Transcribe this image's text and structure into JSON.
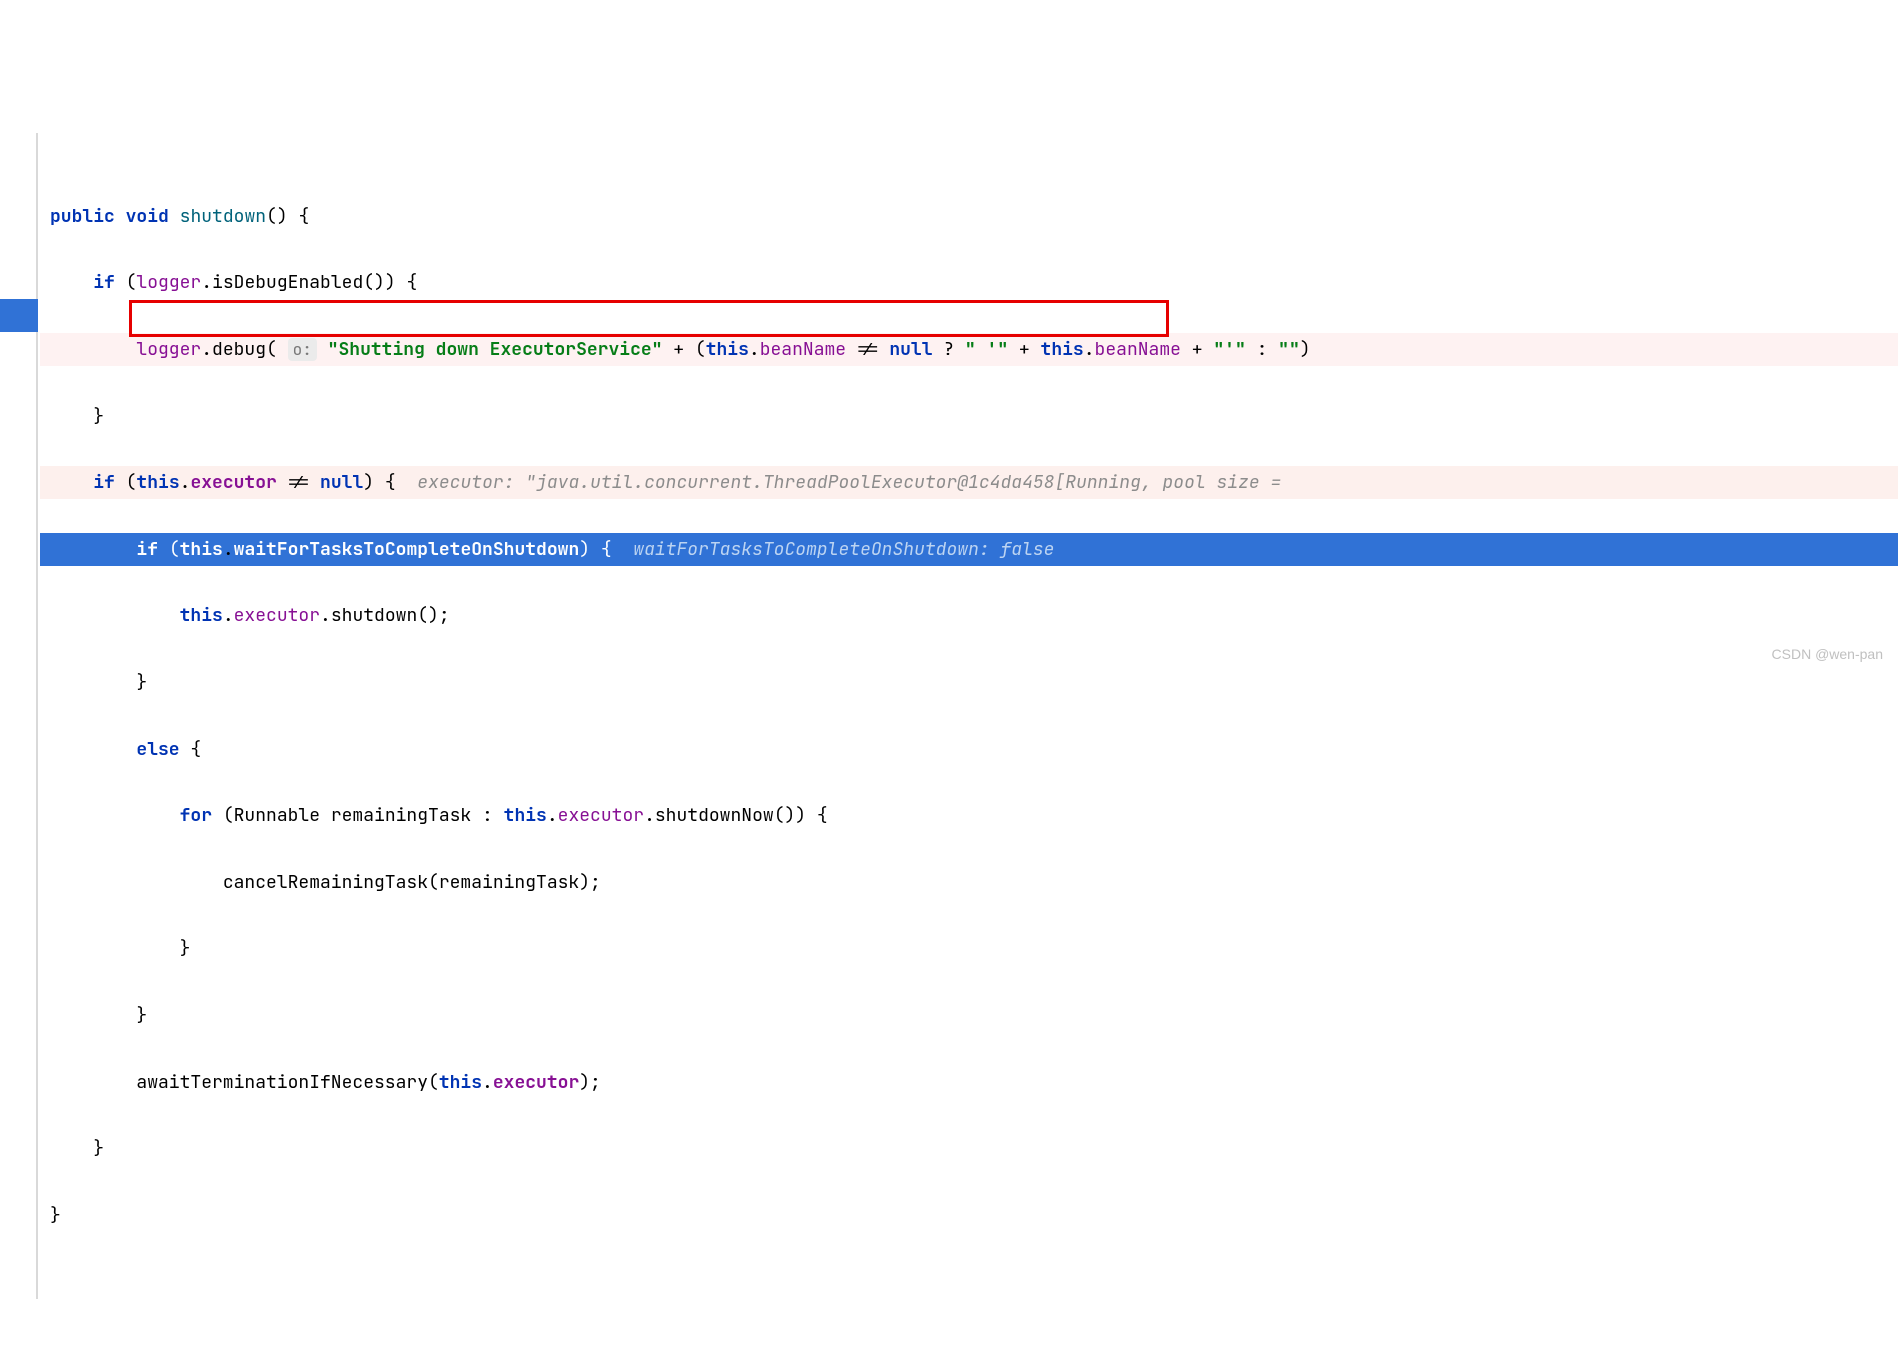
{
  "code": {
    "line1": {
      "kw_public": "public",
      "kw_void": "void",
      "method": "shutdown",
      "parens": "()",
      "brace": " {"
    },
    "line2": {
      "kw_if": "if",
      "lparen": " (",
      "field": "logger",
      "dot": ".",
      "method": "isDebugEnabled",
      "parens": "()",
      "rparen": ")",
      "brace": " {"
    },
    "line3": {
      "field": "logger",
      "dot1": ".",
      "method": "debug",
      "lparen": "(",
      "hint_param": "o:",
      "string1": "\"Shutting down ExecutorService\"",
      "plus1": " + (",
      "kw_this1": "this",
      "dot2": ".",
      "field2": "beanName",
      "neq": " != ",
      "kw_null": "null",
      "qmark": " ? ",
      "string2": "\" '\"",
      "plus2": " + ",
      "kw_this2": "this",
      "dot3": ".",
      "field3": "beanName",
      "plus3": " + ",
      "string3": "\"'\"",
      "colon": " : ",
      "string4": "\"\"",
      "rparen": ")"
    },
    "line4": {
      "brace": "}"
    },
    "line5": {
      "kw_if": "if",
      "lparen": " (",
      "kw_this": "this",
      "dot": ".",
      "field": "executor",
      "neq": " != ",
      "kw_null": "null",
      "rparen": ")",
      "brace": " {",
      "hint": "  executor: \"java.util.concurrent.ThreadPoolExecutor@1c4da458[Running, pool size = "
    },
    "line6": {
      "kw_if": "if",
      "lparen": " (",
      "kw_this": "this",
      "dot": ".",
      "field": "waitForTasksToCompleteOnShutdown",
      "rparen": ")",
      "brace": " {",
      "hint": "  waitForTasksToCompleteOnShutdown: false"
    },
    "line7": {
      "kw_this": "this",
      "dot1": ".",
      "field": "executor",
      "dot2": ".",
      "method": "shutdown",
      "parens": "();"
    },
    "line8": {
      "brace": "}"
    },
    "line9": {
      "kw_else": "else",
      "brace": " {"
    },
    "line10": {
      "kw_for": "for",
      "lparen": " (",
      "type": "Runnable ",
      "var": "remainingTask",
      "colon": " : ",
      "kw_this": "this",
      "dot1": ".",
      "field": "executor",
      "dot2": ".",
      "method": "shutdownNow",
      "parens": "())",
      "brace": " {"
    },
    "line11": {
      "method": "cancelRemainingTask",
      "lparen": "(",
      "var": "remainingTask",
      "rparen": ");"
    },
    "line12": {
      "brace": "}"
    },
    "line13": {
      "brace": "}"
    },
    "line14": {
      "method": "awaitTerminationIfNecessary",
      "lparen": "(",
      "kw_this": "this",
      "dot": ".",
      "field": "executor",
      "rparen": ");"
    },
    "line15": {
      "brace": "}"
    },
    "line16": {
      "brace": "}"
    }
  },
  "watermark": "CSDN @wen-pan"
}
